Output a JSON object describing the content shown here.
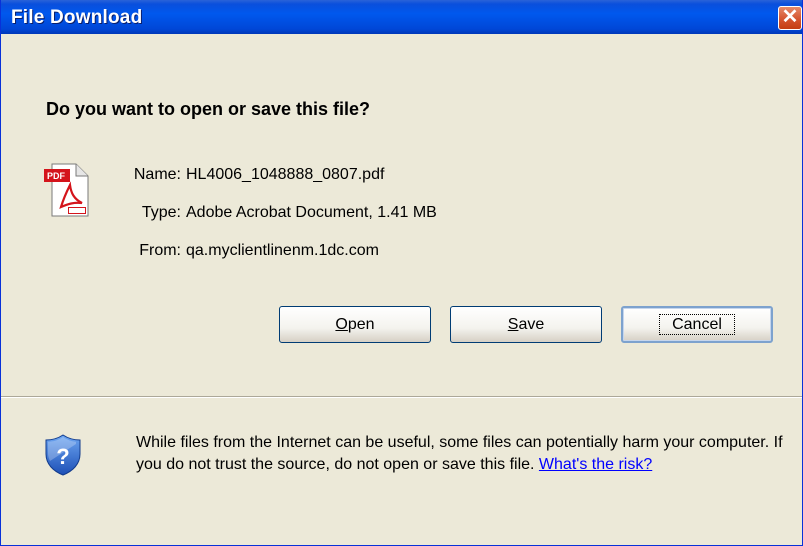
{
  "window": {
    "title": "File Download",
    "close_symbol": "✕"
  },
  "dialog": {
    "question": "Do you want to open or save this file?",
    "file_icon": "pdf-icon",
    "fields": [
      {
        "label": "Name:",
        "value": "HL4006_1048888_0807.pdf"
      },
      {
        "label": "Type:",
        "value": "Adobe Acrobat Document, 1.41 MB"
      },
      {
        "label": "From:",
        "value": "qa.myclientlinenm.1dc.com"
      }
    ],
    "buttons": {
      "open": {
        "mnemonic": "O",
        "rest": "pen"
      },
      "save": {
        "mnemonic": "S",
        "rest": "ave"
      },
      "cancel": "Cancel"
    }
  },
  "warning": {
    "icon": "shield-question-icon",
    "text": "While files from the Internet can be useful, some files can potentially harm your computer. If you do not trust the source, do not open or save this file.",
    "link": "What's the risk?"
  },
  "colors": {
    "titlebar": "#0058ee",
    "face": "#ece9d8",
    "link": "#0000ff",
    "close": "#d55530"
  }
}
